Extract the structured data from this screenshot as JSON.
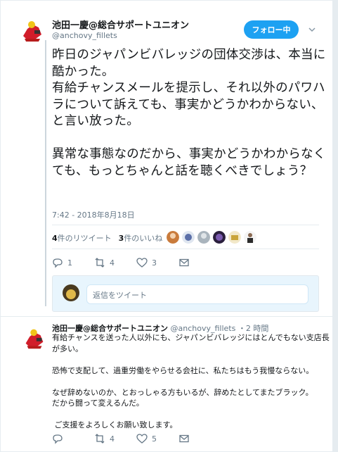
{
  "tweet": {
    "author_name": "池田一慶@総合サポートユニオン",
    "author_handle": "@anchovy_fillets",
    "follow_label": "フォロー中",
    "text": "昨日のジャパンビバレッジの団体交渉は、本当に酷かった。\n有給チャンスメールを提示し、それ以外のパワハラについて訴えても、事実かどうかわからない、と言い放った。\n\n異常な事態なのだから、事実かどうかわからなくても、もっとちゃんと話を聴くべきでしょう？",
    "timestamp": "7:42 - 2018年8月18日",
    "retweet_count": "4",
    "retweet_label": "件のリツイート",
    "like_count": "3",
    "like_label": "件のいいね",
    "actions": {
      "reply": "1",
      "retweet": "4",
      "like": "3"
    }
  },
  "reply_box": {
    "placeholder": "返信をツイート"
  },
  "reply_tweet": {
    "author_name": "池田一慶@総合サポートユニオン",
    "author_handle": "@anchovy_fillets",
    "time": "・2 時間",
    "text": "有給チャンスを送った人以外にも、ジャパンビバレッジにはとんでもない支店長が多い。\n\n恐怖で支配して、過重労働をやらせる会社に、私たちはもう我慢ならない。\n\nなぜ辞めないのか、とおっしゃる方もいるが、辞めたとしてまたブラック。\nだから闘って変えるんだ。\n\n ご支援をよろしくお願い致します。",
    "actions": {
      "reply": "",
      "retweet": "4",
      "like": "5"
    }
  },
  "colors": {
    "accent": "#1da1f2",
    "muted": "#657786",
    "border": "#e6ecf0"
  },
  "icons": [
    "reply-icon",
    "retweet-icon",
    "heart-icon",
    "mail-icon",
    "chevron-down-icon"
  ]
}
